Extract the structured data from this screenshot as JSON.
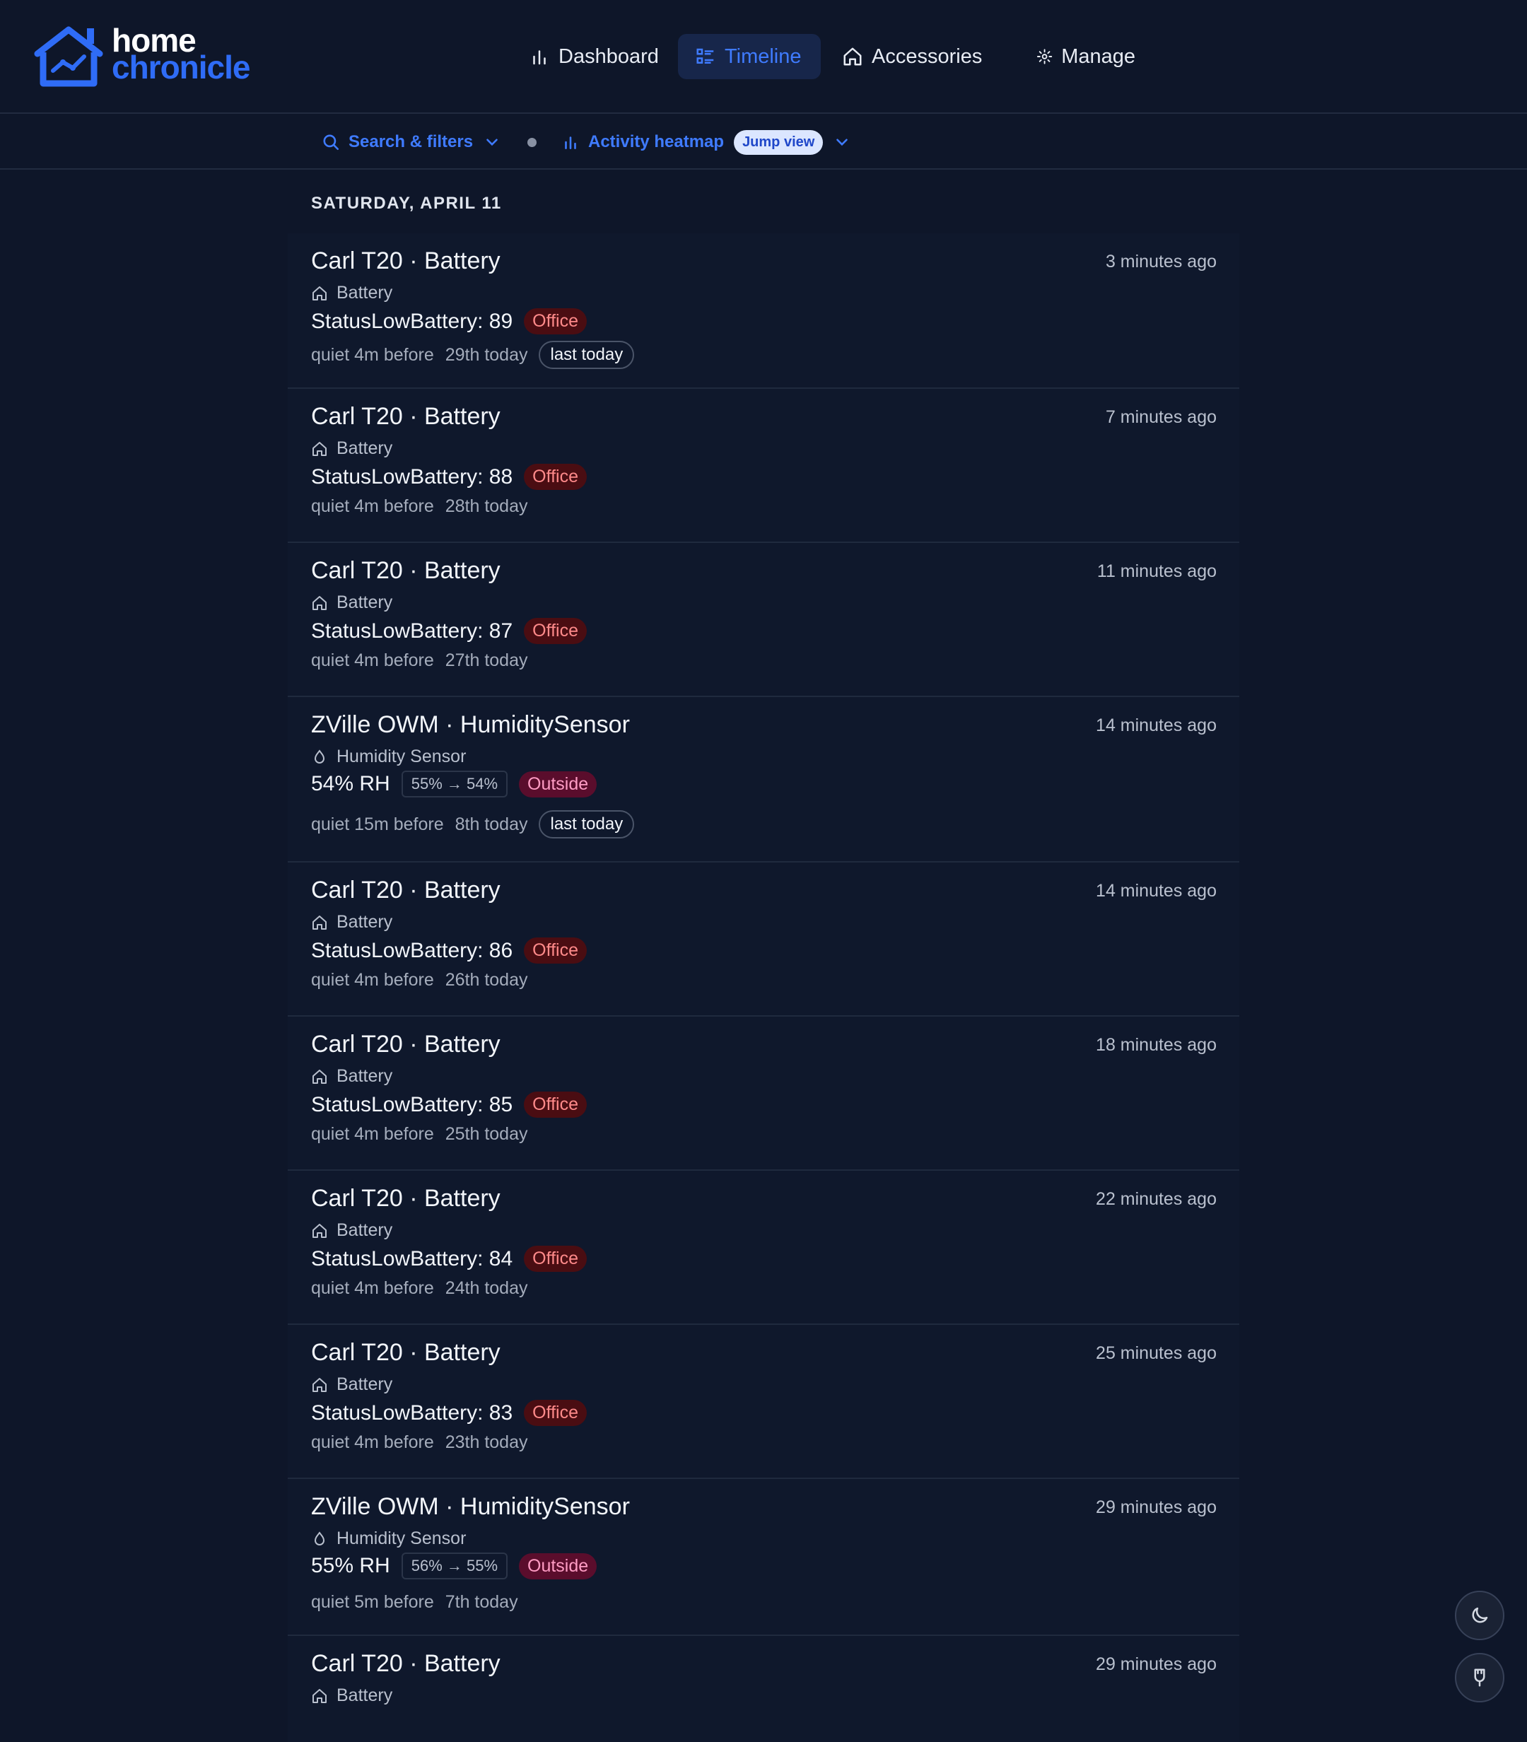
{
  "app": {
    "logo_line1": "home",
    "logo_line2": "chronicle"
  },
  "nav": {
    "dashboard": "Dashboard",
    "timeline": "Timeline",
    "accessories": "Accessories",
    "manage": "Manage"
  },
  "subbar": {
    "search": "Search & filters",
    "heatmap": "Activity heatmap",
    "jump": "Jump view"
  },
  "date_header": "SATURDAY, APRIL 11",
  "events": [
    {
      "title": "Carl T20 · Battery",
      "type": "Battery",
      "value": "StatusLowBattery: 89",
      "room": "Office",
      "quiet": "quiet 4m before",
      "rank": "29th today",
      "last": "last today",
      "time": "3 minutes ago"
    },
    {
      "title": "Carl T20 · Battery",
      "type": "Battery",
      "value": "StatusLowBattery: 88",
      "room": "Office",
      "quiet": "quiet 4m before",
      "rank": "28th today",
      "time": "7 minutes ago"
    },
    {
      "title": "Carl T20 · Battery",
      "type": "Battery",
      "value": "StatusLowBattery: 87",
      "room": "Office",
      "quiet": "quiet 4m before",
      "rank": "27th today",
      "time": "11 minutes ago"
    },
    {
      "title": "ZVille OWM · HumiditySensor",
      "type": "Humidity Sensor",
      "value": "54% RH",
      "delta": "55% → 54%",
      "room": "Outside",
      "quiet": "quiet 15m before",
      "rank": "8th today",
      "last": "last today",
      "time": "14 minutes ago"
    },
    {
      "title": "Carl T20 · Battery",
      "type": "Battery",
      "value": "StatusLowBattery: 86",
      "room": "Office",
      "quiet": "quiet 4m before",
      "rank": "26th today",
      "time": "14 minutes ago"
    },
    {
      "title": "Carl T20 · Battery",
      "type": "Battery",
      "value": "StatusLowBattery: 85",
      "room": "Office",
      "quiet": "quiet 4m before",
      "rank": "25th today",
      "time": "18 minutes ago"
    },
    {
      "title": "Carl T20 · Battery",
      "type": "Battery",
      "value": "StatusLowBattery: 84",
      "room": "Office",
      "quiet": "quiet 4m before",
      "rank": "24th today",
      "time": "22 minutes ago"
    },
    {
      "title": "Carl T20 · Battery",
      "type": "Battery",
      "value": "StatusLowBattery: 83",
      "room": "Office",
      "quiet": "quiet 4m before",
      "rank": "23th today",
      "time": "25 minutes ago"
    },
    {
      "title": "ZVille OWM · HumiditySensor",
      "type": "Humidity Sensor",
      "value": "55% RH",
      "delta": "56% → 55%",
      "room": "Outside",
      "quiet": "quiet 5m before",
      "rank": "7th today",
      "time": "29 minutes ago"
    },
    {
      "title": "Carl T20 · Battery",
      "type": "Battery",
      "time": "29 minutes ago"
    }
  ],
  "icons": {
    "nav_dashboard": "bar-chart-icon",
    "nav_timeline": "list-icon",
    "nav_accessories": "home-icon",
    "nav_manage": "gear-icon",
    "theme": "moon-icon",
    "extra": "plug-icon"
  },
  "colors": {
    "accent": "#3f7bff",
    "office": "#ff8a8a",
    "outside": "#ff9cc4"
  }
}
